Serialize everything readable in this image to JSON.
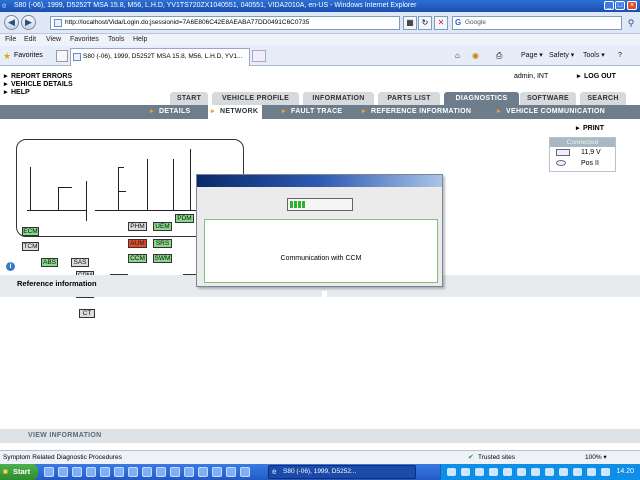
{
  "browser": {
    "title": "S80 (-06), 1999, D5252T MSA 15.8, M56, L.H.D, YV1TS720ZX1040551, 040551, VIDA2010A, en-US - Windows Internet Explorer",
    "url": "http://localhost/Vida/Login.do;jsessionid=7A6E806C42E8AEABA77DD0491C6C0735",
    "search_placeholder": "Google",
    "menu": [
      "File",
      "Edit",
      "View",
      "Favorites",
      "Tools",
      "Help"
    ],
    "favorites_label": "Favorites",
    "tab_title": "S80 (-06), 1999, D5252T MSA 15.8, M56, L.H.D, YV1...",
    "commands": [
      "Page ▾",
      "Safety ▾",
      "Tools ▾",
      "?"
    ]
  },
  "header": {
    "left_links": [
      "REPORT ERRORS",
      "VEHICLE DETAILS",
      "HELP"
    ],
    "user": "admin, INT",
    "logout": "LOG OUT"
  },
  "main_tabs": [
    {
      "label": "START",
      "active": false
    },
    {
      "label": "VEHICLE PROFILE",
      "active": false
    },
    {
      "label": "INFORMATION",
      "active": false
    },
    {
      "label": "PARTS LIST",
      "active": false
    },
    {
      "label": "DIAGNOSTICS",
      "active": true
    },
    {
      "label": "SOFTWARE",
      "active": false
    },
    {
      "label": "SEARCH",
      "active": false
    }
  ],
  "sub_tabs": [
    {
      "label": "DETAILS",
      "active": false
    },
    {
      "label": "NETWORK",
      "active": true
    },
    {
      "label": "FAULT TRACE",
      "active": false
    },
    {
      "label": "REFERENCE INFORMATION",
      "active": false
    },
    {
      "label": "VEHICLE COMMUNICATION",
      "active": false
    }
  ],
  "network": {
    "ecus": [
      {
        "id": "ECM",
        "status": "green"
      },
      {
        "id": "TCM",
        "status": "grey"
      },
      {
        "id": "ABS",
        "status": "green"
      },
      {
        "id": "SAS",
        "status": "grey"
      },
      {
        "id": "CPM",
        "status": "grey"
      },
      {
        "id": "CEM",
        "status": "green"
      },
      {
        "id": "CT",
        "status": "grey"
      },
      {
        "id": "PHM",
        "status": "grey"
      },
      {
        "id": "AUM",
        "status": "red"
      },
      {
        "id": "CCM",
        "status": "green"
      },
      {
        "id": "DIM",
        "status": "green"
      },
      {
        "id": "UEM",
        "status": "green"
      },
      {
        "id": "SRS",
        "status": "green"
      },
      {
        "id": "SWM",
        "status": "green"
      },
      {
        "id": "PSM",
        "status": "grey"
      },
      {
        "id": "PDM",
        "status": "green"
      },
      {
        "id": "DDM",
        "status": "green"
      }
    ]
  },
  "connection": {
    "print_label": "PRINT",
    "status": "Connected",
    "voltage": "11,9 V",
    "ignition": "Pos II"
  },
  "reference": {
    "title": "Reference information"
  },
  "view_information": "VIEW INFORMATION",
  "dialog": {
    "message": "Communication with CCM",
    "progress_blocks": 4
  },
  "status_bar": {
    "text": "Symptom Related Diagnostic Procedures",
    "zone": "Trusted sites",
    "zoom": "100% ▾"
  },
  "taskbar": {
    "start": "Start",
    "task": "S80 (-06), 1999, D5252...",
    "clock": "14.20"
  },
  "colors": {
    "ecu_green": "#8ad88a",
    "ecu_red": "#e14b2a",
    "tab_active": "#6d7d8c",
    "accent_arrow": "#f0a020"
  }
}
